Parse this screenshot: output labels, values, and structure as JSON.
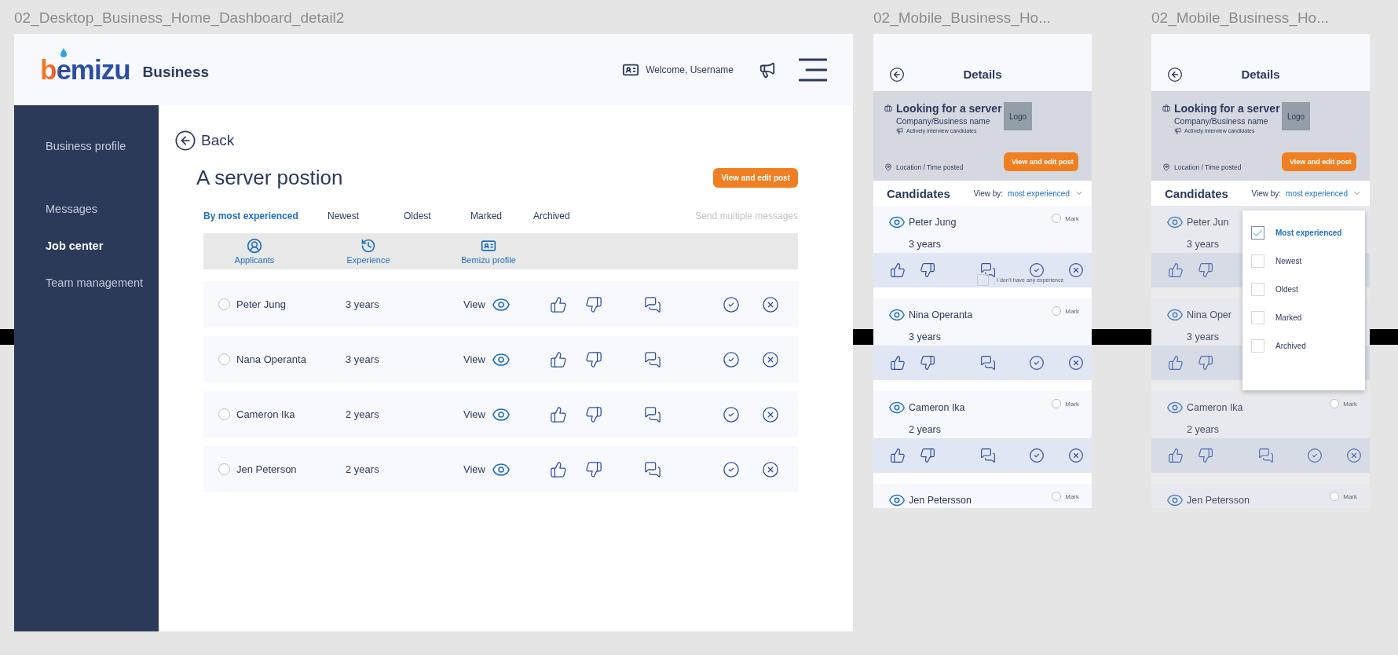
{
  "desktop_frame": {
    "label": "02_Desktop_Business_Home_Dashboard_detail2",
    "header": {
      "logo": "bemizu",
      "product": "Business",
      "welcome": "Welcome, Username"
    },
    "sidebar": [
      {
        "label": "Business profile",
        "selected": false
      },
      {
        "label": "Messages",
        "selected": false
      },
      {
        "label": "Job center",
        "selected": true
      },
      {
        "label": "Team management",
        "selected": false
      }
    ],
    "back": "Back",
    "title": "A server postion",
    "edit_button": "View and edit post",
    "filters": [
      {
        "label": "By most experienced",
        "selected": true
      },
      {
        "label": "Newest",
        "selected": false
      },
      {
        "label": "Oldest",
        "selected": false
      },
      {
        "label": "Marked",
        "selected": false
      },
      {
        "label": "Archived",
        "selected": false
      }
    ],
    "send_multiple": {
      "label": "Send multiple messages",
      "disabled": true
    },
    "columns": [
      {
        "label": "Applicants",
        "kind": "applicants"
      },
      {
        "label": "Experience",
        "kind": "experience"
      },
      {
        "label": "Bemizu profile",
        "kind": "profile"
      }
    ],
    "rows": [
      {
        "name": "Peter Jung",
        "experience": "3 years",
        "view": "View",
        "marked": false
      },
      {
        "name": "Nana Operanta",
        "experience": "3 years",
        "view": "View",
        "marked": false
      },
      {
        "name": "Cameron Ika",
        "experience": "2 years",
        "view": "View",
        "marked": false
      },
      {
        "name": "Jen Peterson",
        "experience": "2 years",
        "view": "View",
        "marked": false
      }
    ]
  },
  "mobile_frames": [
    {
      "label": "02_Mobile_Business_Ho...",
      "title": "Details",
      "post": {
        "title": "Looking for a server",
        "company": "Company/Business name",
        "status": "Actively interview candidates",
        "location": "Location / Time posted",
        "logo": "Logo",
        "button": "View and edit post"
      },
      "candidates_title": "Candidates",
      "view_by_label": "View by:",
      "view_by_value": "most experienced",
      "dimmed": false,
      "candidates": [
        {
          "name": "Peter Jung",
          "experience": "3 years",
          "mark": "Mark",
          "marked": false,
          "actions": [
            {
              "kind": "like"
            },
            {
              "kind": "dislike"
            },
            {
              "kind": "chat"
            },
            {
              "kind": "accept"
            },
            {
              "kind": "reject"
            }
          ],
          "note": "I don't have any experience"
        },
        {
          "name": "Nina Operanta",
          "experience": "3 years",
          "mark": "Mark",
          "marked": false,
          "actions": [
            {
              "kind": "like"
            },
            {
              "kind": "dislike"
            },
            {
              "kind": "chat"
            },
            {
              "kind": "accept"
            },
            {
              "kind": "reject"
            }
          ]
        },
        {
          "name": "Cameron Ika",
          "experience": "2 years",
          "mark": "Mark",
          "marked": false,
          "actions": [
            {
              "kind": "like"
            },
            {
              "kind": "dislike"
            },
            {
              "kind": "chat"
            },
            {
              "kind": "accept"
            },
            {
              "kind": "reject"
            }
          ]
        },
        {
          "name": "Jen Petersson",
          "mark": "Mark",
          "marked": false
        }
      ]
    },
    {
      "label": "02_Mobile_Business_Ho...",
      "title": "Details",
      "post": {
        "title": "Looking for a server",
        "company": "Company/Business name",
        "status": "Actively interview candidates",
        "location": "Location / Time posted",
        "logo": "Logo",
        "button": "View and edit post"
      },
      "candidates_title": "Candidates",
      "view_by_label": "View by:",
      "view_by_value": "most experienced",
      "dimmed": true,
      "candidates": [
        {
          "name": "Peter Jun",
          "experience": "3 years",
          "actions": [
            {
              "kind": "like"
            },
            {
              "kind": "dislike"
            }
          ]
        },
        {
          "name": "Nina Oper",
          "experience": "3 years",
          "actions": [
            {
              "kind": "like"
            },
            {
              "kind": "dislike"
            }
          ]
        },
        {
          "name": "Cameron Ika",
          "experience": "2 years",
          "mark": "Mark",
          "marked": false,
          "actions": [
            {
              "kind": "like"
            },
            {
              "kind": "dislike"
            },
            {
              "kind": "chat"
            },
            {
              "kind": "accept"
            },
            {
              "kind": "reject"
            }
          ]
        },
        {
          "name": "Jen Petersson",
          "mark": "Mark",
          "marked": false
        }
      ],
      "dropdown": {
        "options": [
          {
            "label": "Most experienced",
            "checked": true
          },
          {
            "label": "Newest",
            "checked": false
          },
          {
            "label": "Oldest",
            "checked": false
          },
          {
            "label": "Marked",
            "checked": false
          },
          {
            "label": "Archived",
            "checked": false
          }
        ]
      }
    }
  ]
}
